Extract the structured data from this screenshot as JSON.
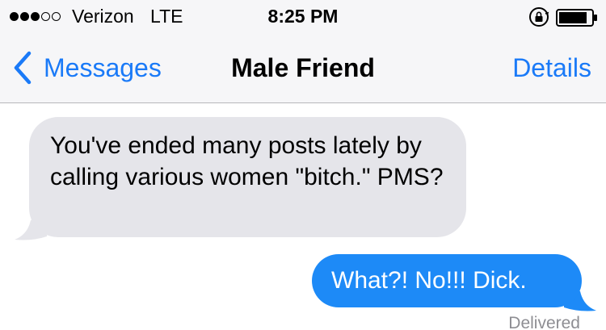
{
  "status_bar": {
    "signal_bars_filled": 3,
    "signal_bars_total": 5,
    "carrier": "Verizon",
    "network": "LTE",
    "time": "8:25 PM",
    "icons": [
      "orientation-lock-icon",
      "battery-icon"
    ]
  },
  "nav": {
    "back_label": "Messages",
    "title": "Male Friend",
    "details_label": "Details"
  },
  "messages": [
    {
      "direction": "incoming",
      "text": "You've ended many posts lately by calling various women \"bitch.\" PMS?"
    },
    {
      "direction": "outgoing",
      "text": "What?! No!!! Dick."
    }
  ],
  "delivery_status": "Delivered",
  "colors": {
    "accent": "#1a7af8",
    "incoming_bubble": "#e5e5ea",
    "outgoing_bubble": "#1d8af7",
    "header_bg": "#f6f6f8",
    "status_text": "#8e8e93"
  }
}
